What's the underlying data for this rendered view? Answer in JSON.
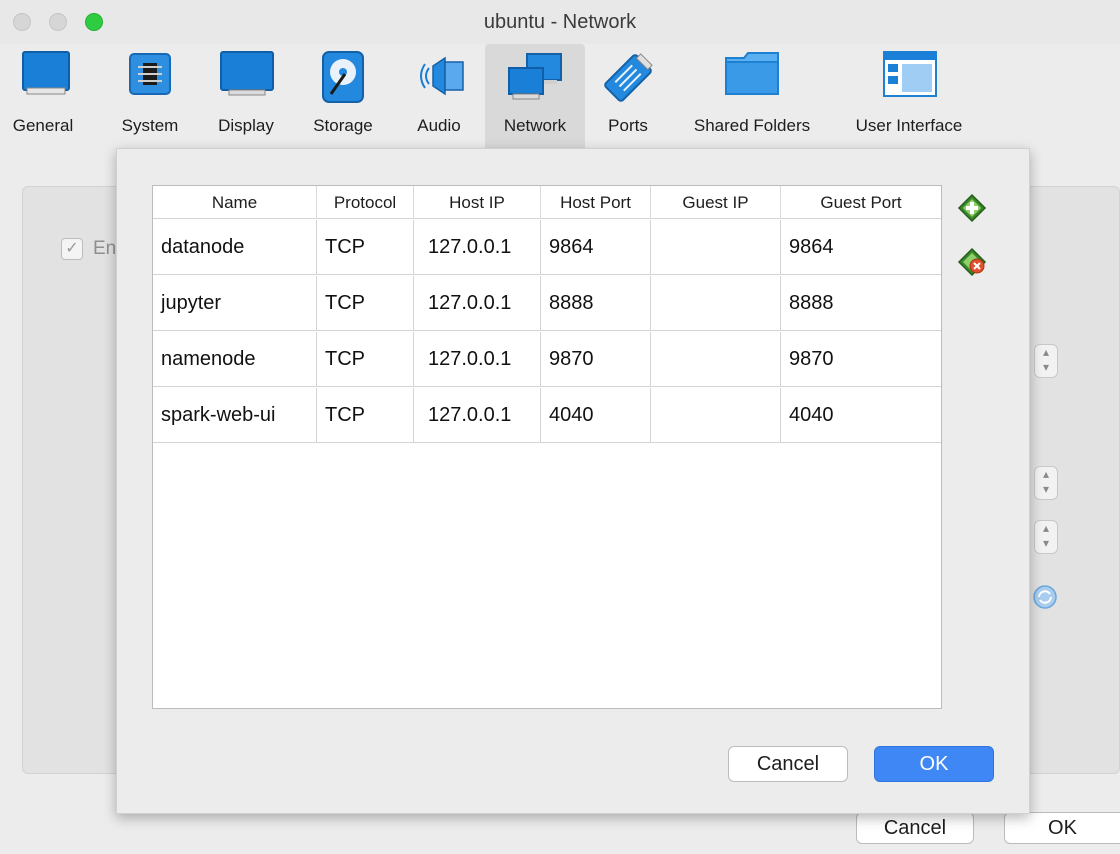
{
  "window": {
    "title": "ubuntu - Network"
  },
  "toolbar": {
    "items": [
      {
        "label": "General",
        "icon": "general-icon"
      },
      {
        "label": "System",
        "icon": "system-chip-icon"
      },
      {
        "label": "Display",
        "icon": "display-monitor-icon"
      },
      {
        "label": "Storage",
        "icon": "storage-disk-icon"
      },
      {
        "label": "Audio",
        "icon": "audio-speaker-icon"
      },
      {
        "label": "Network",
        "icon": "network-icon",
        "active": true
      },
      {
        "label": "Ports",
        "icon": "ports-connector-icon"
      },
      {
        "label": "Shared Folders",
        "icon": "shared-folder-icon"
      },
      {
        "label": "User Interface",
        "icon": "user-interface-icon"
      }
    ]
  },
  "background": {
    "checkbox_label": "En",
    "cancel_label": "Cancel",
    "ok_label": "OK"
  },
  "port_forwarding": {
    "columns": [
      "Name",
      "Protocol",
      "Host IP",
      "Host Port",
      "Guest IP",
      "Guest Port"
    ],
    "rows": [
      [
        "datanode",
        "TCP",
        "127.0.0.1",
        "9864",
        "",
        "9864"
      ],
      [
        "jupyter",
        "TCP",
        "127.0.0.1",
        "8888",
        "",
        "8888"
      ],
      [
        "namenode",
        "TCP",
        "127.0.0.1",
        "9870",
        "",
        "9870"
      ],
      [
        "spark-web-ui",
        "TCP",
        "127.0.0.1",
        "4040",
        "",
        "4040"
      ]
    ],
    "add_rule_icon": "add-rule-icon",
    "remove_rule_icon": "remove-rule-icon",
    "cancel_label": "Cancel",
    "ok_label": "OK"
  },
  "colors": {
    "accent": "#3e87f5",
    "active_tab": "#d9d9d9"
  }
}
